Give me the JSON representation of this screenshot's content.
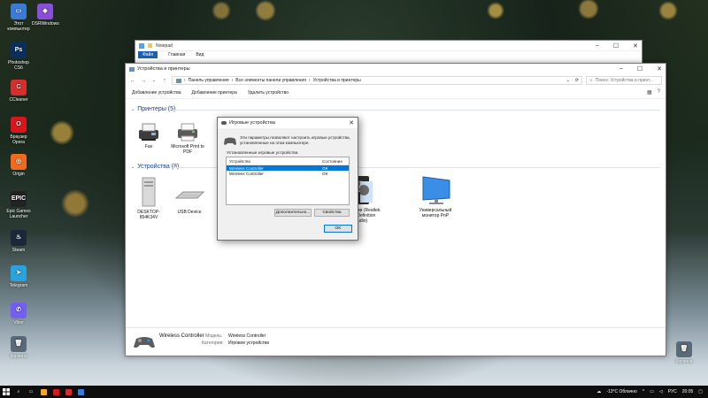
{
  "desktop": {
    "icons": [
      {
        "label": "Этот компьютер",
        "color": "#3a7bd5",
        "glyph": "▭"
      },
      {
        "label": "DSRWindows",
        "color": "#8a4fd8",
        "glyph": "◆"
      },
      {
        "label": "Photoshop CS6",
        "color": "#0b2f5c",
        "glyph": "Ps"
      },
      {
        "label": "CCleaner",
        "color": "#d32f2f",
        "glyph": "C"
      },
      {
        "label": "Браузер Opera",
        "color": "#d8161e",
        "glyph": "O"
      },
      {
        "label": "Origin",
        "color": "#f26a1b",
        "glyph": "◎"
      },
      {
        "label": "Epic Games Launcher",
        "color": "#222222",
        "glyph": "EPIC"
      },
      {
        "label": "Steam",
        "color": "#1b2838",
        "glyph": "♨"
      },
      {
        "label": "Telegram",
        "color": "#2aa3e1",
        "glyph": "➤"
      },
      {
        "label": "Viber",
        "color": "#7360f2",
        "glyph": "✆"
      },
      {
        "label": "Корзина",
        "color": "#5a6a78",
        "glyph": "🗑"
      },
      {
        "label": "Корзина",
        "color": "#5a6a78",
        "glyph": "🗑"
      }
    ]
  },
  "notepad": {
    "title": "Notepad",
    "tabs": [
      "Файл",
      "Главная",
      "Вид"
    ]
  },
  "explorer": {
    "title": "Устройства и принтеры",
    "breadcrumb": [
      "Панель управления",
      "Все элементы панели управления",
      "Устройства и принтеры"
    ],
    "search_placeholder": "Поиск: Устройства и принт...",
    "commands": [
      "Добавление устройства",
      "Добавление принтера",
      "Удалить устройство"
    ],
    "printers_header": "Принтеры (5)",
    "devices_header": "Устройства (8)",
    "printers": [
      {
        "label": "Fax",
        "icon": "fax-icon"
      },
      {
        "label": "Microsoft Print to PDF",
        "icon": "printer-icon"
      }
    ],
    "devices": [
      {
        "label": "DESKTOP-854K34V",
        "icon": "computer-icon"
      },
      {
        "label": "USB Device",
        "icon": "keyboard-icon"
      },
      {
        "label": "Динамики (Realtek High Definition Audio)",
        "icon": "speaker-icon"
      },
      {
        "label": "Универсальный монитор PnP",
        "icon": "monitor-icon"
      }
    ],
    "details": {
      "name": "Wireless Controller",
      "model_label": "Модель:",
      "model_value": "Wireless Controller",
      "category_label": "Категория:",
      "category_value": "Игровое устройство"
    }
  },
  "dialog": {
    "title": "Игровые устройства",
    "description": "Эти параметры позволяют настроить игровые устройства, установленные на этом компьютере.",
    "installed_label": "Установленные игровые устройства",
    "col_device": "Устройство",
    "col_status": "Состояние",
    "rows": [
      {
        "device": "Wireless Controller",
        "status": "OK"
      },
      {
        "device": "Wireless Controller",
        "status": "OK"
      }
    ],
    "advanced_button": "Дополнительно...",
    "properties_button": "Свойства",
    "ok_button": "OK"
  },
  "taskbar": {
    "weather": "-13°C Облачно",
    "lang": "РУС",
    "time": "20:05",
    "apps_colors": [
      "#f5a623",
      "#d8161e",
      "#d32f2f",
      "#3a7bd5"
    ]
  }
}
